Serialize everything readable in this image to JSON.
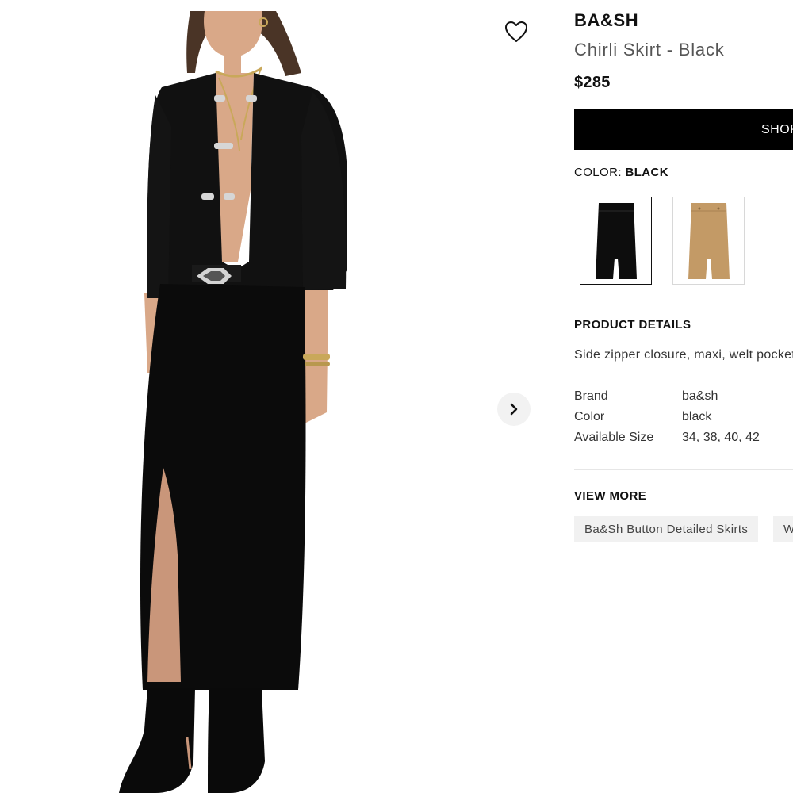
{
  "product": {
    "brand": "BA&SH",
    "name": "Chirli Skirt - Black",
    "price": "$285"
  },
  "gallery": {
    "favorite_icon": "heart-outline-icon",
    "next_icon": "chevron-right-icon"
  },
  "actions": {
    "shop_label": "SHOP"
  },
  "color": {
    "label": "COLOR: ",
    "selected": "BLACK",
    "swatches": [
      {
        "name": "black",
        "hex": "#0d0d0d"
      },
      {
        "name": "camel",
        "hex": "#c39a66"
      }
    ]
  },
  "details": {
    "title": "PRODUCT DETAILS",
    "description": "Side zipper closure, maxi, welt pockets",
    "specs": [
      {
        "key": "Brand",
        "value": "ba&sh"
      },
      {
        "key": "Color",
        "value": "black"
      },
      {
        "key": "Available Size",
        "value": "34, 38, 40, 42"
      }
    ]
  },
  "view_more": {
    "title": "VIEW MORE",
    "tags": [
      "Ba&Sh Button Detailed Skirts",
      "W"
    ]
  }
}
